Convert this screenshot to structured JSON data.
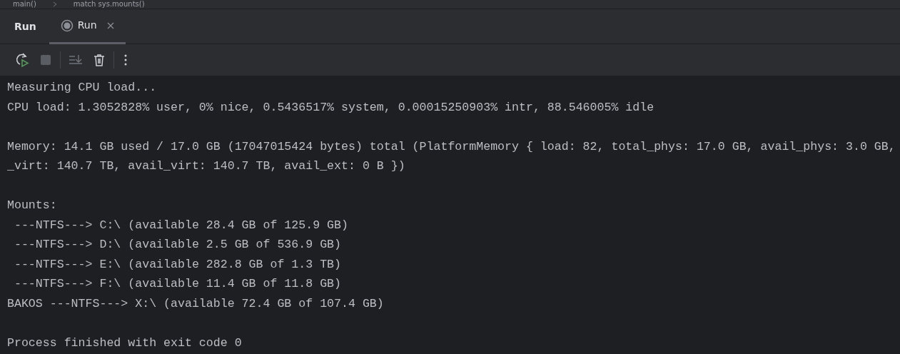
{
  "breadcrumbs": [
    "main()",
    "match sys.mounts()"
  ],
  "tool_window": {
    "title": "Run"
  },
  "tabs": [
    {
      "label": "Run",
      "selected": true,
      "closable": true
    }
  ],
  "console": {
    "blocks": [
      [
        "Measuring CPU load...",
        "CPU load: 1.3052828% user, 0% nice, 0.5436517% system, 0.00015250903% intr, 88.546005% idle"
      ],
      [
        "Memory: 14.1 GB used / 17.0 GB (17047015424 bytes) total (PlatformMemory { load: 82, total_phys: 17.0 GB, avail_phys: 3.0 GB,",
        "_virt: 140.7 TB, avail_virt: 140.7 TB, avail_ext: 0 B })"
      ],
      [
        "Mounts:",
        " ---NTFS---> C:\\ (available 28.4 GB of 125.9 GB)",
        " ---NTFS---> D:\\ (available 2.5 GB of 536.9 GB)",
        " ---NTFS---> E:\\ (available 282.8 GB of 1.3 TB)",
        " ---NTFS---> F:\\ (available 11.4 GB of 11.8 GB)",
        "BAKOS ---NTFS---> X:\\ (available 72.4 GB of 107.4 GB)"
      ],
      [
        "Process finished with exit code 0"
      ]
    ]
  }
}
